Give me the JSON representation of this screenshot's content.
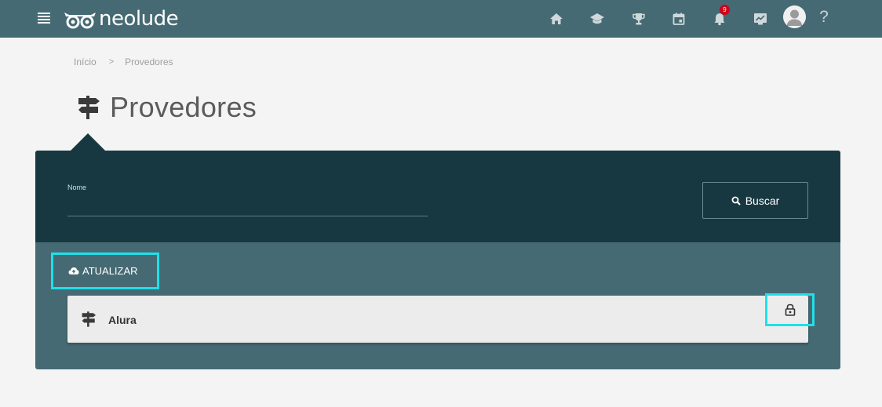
{
  "app": {
    "name": "neolude",
    "colors": {
      "topbar": "#466a73",
      "panel_dark": "#183841",
      "panel": "#466a73",
      "highlight": "#1fe0ea",
      "badge": "#d0021b"
    }
  },
  "header": {
    "menu_icon": "hamburger-menu-icon",
    "nav_icons": [
      "home-icon",
      "graduation-cap-icon",
      "trophy-icon",
      "calendar-icon",
      "bell-icon",
      "presentation-chart-icon"
    ],
    "notifications_count": "9",
    "help_label": "?"
  },
  "breadcrumb": {
    "home": "Início",
    "separator": ">",
    "current": "Provedores"
  },
  "page": {
    "title": "Provedores",
    "title_icon": "signpost-icon"
  },
  "search": {
    "label": "Nome",
    "value": "",
    "button_label": "Buscar"
  },
  "actions": {
    "update_label": "ATUALIZAR",
    "update_icon": "cloud-upload-icon"
  },
  "providers": [
    {
      "name": "Alura",
      "icon": "signpost-icon",
      "action_icon": "lock-icon"
    }
  ]
}
